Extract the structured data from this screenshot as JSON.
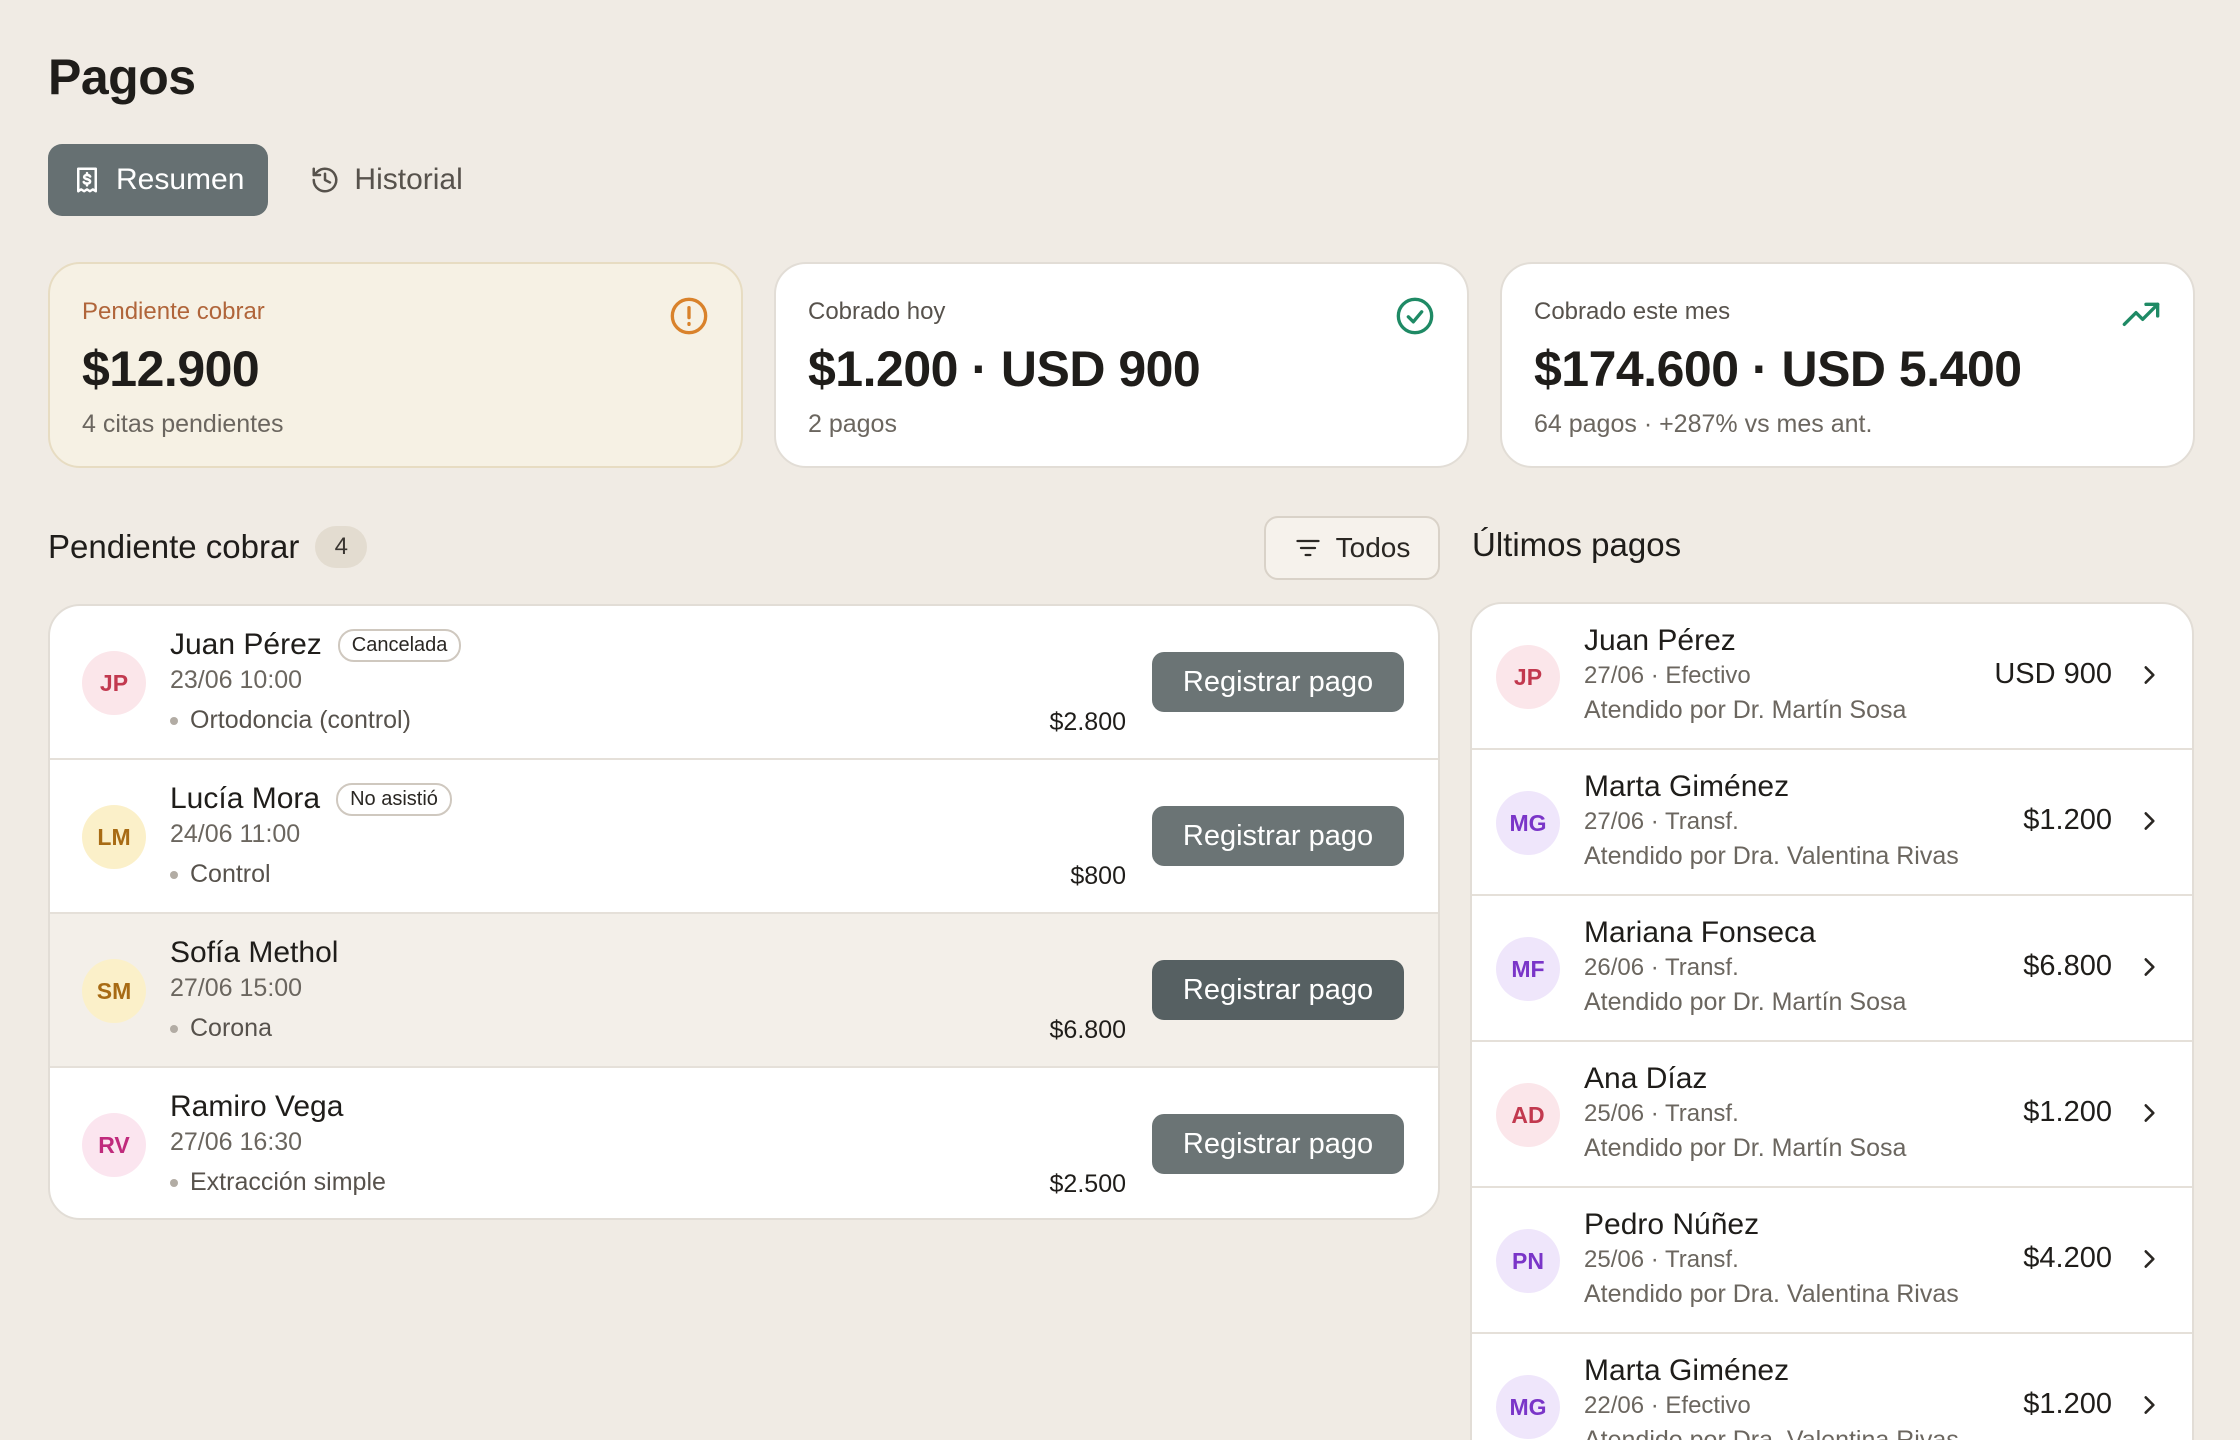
{
  "page": {
    "title": "Pagos"
  },
  "tabs": [
    {
      "label": "Resumen",
      "icon": "receipt-icon",
      "active": true
    },
    {
      "label": "Historial",
      "icon": "history-icon",
      "active": false
    }
  ],
  "summary_cards": [
    {
      "label": "Pendiente cobrar",
      "value": "$12.900",
      "sub": "4 citas pendientes",
      "icon": "alert-circle-icon",
      "accent": "#d9822b"
    },
    {
      "label": "Cobrado hoy",
      "value": "$1.200 · USD 900",
      "sub": "2 pagos",
      "icon": "check-circle-icon",
      "accent": "#1f8a65"
    },
    {
      "label": "Cobrado este mes",
      "value": "$174.600 · USD 5.400",
      "sub": "64 pagos · +287% vs mes ant.",
      "icon": "trending-up-icon",
      "accent": "#1f8a65"
    }
  ],
  "pending": {
    "title": "Pendiente cobrar",
    "count": "4",
    "filter_label": "Todos",
    "register_label": "Registrar pago",
    "rows": [
      {
        "initials": "JP",
        "name": "Juan Pérez",
        "status": "Cancelada",
        "datetime": "23/06 10:00",
        "treatment": "Ortodoncia (control)",
        "amount": "$2.800",
        "color": "red"
      },
      {
        "initials": "LM",
        "name": "Lucía Mora",
        "status": "No asistió",
        "datetime": "24/06 11:00",
        "treatment": "Control",
        "amount": "$800",
        "color": "yellow"
      },
      {
        "initials": "SM",
        "name": "Sofía Methol",
        "status": "",
        "datetime": "27/06 15:00",
        "treatment": "Corona",
        "amount": "$6.800",
        "color": "yellow"
      },
      {
        "initials": "RV",
        "name": "Ramiro Vega",
        "status": "",
        "datetime": "27/06 16:30",
        "treatment": "Extracción simple",
        "amount": "$2.500",
        "color": "pink"
      }
    ]
  },
  "recent": {
    "title": "Últimos pagos",
    "rows": [
      {
        "initials": "JP",
        "name": "Juan Pérez",
        "meta": "27/06 · Efectivo",
        "by": "Atendido por Dr. Martín Sosa",
        "amount": "USD 900",
        "color": "red"
      },
      {
        "initials": "MG",
        "name": "Marta Giménez",
        "meta": "27/06 · Transf.",
        "by": "Atendido por Dra. Valentina Rivas",
        "amount": "$1.200",
        "color": "purple"
      },
      {
        "initials": "MF",
        "name": "Mariana Fonseca",
        "meta": "26/06 · Transf.",
        "by": "Atendido por Dr. Martín Sosa",
        "amount": "$6.800",
        "color": "purple"
      },
      {
        "initials": "AD",
        "name": "Ana Díaz",
        "meta": "25/06 · Transf.",
        "by": "Atendido por Dr. Martín Sosa",
        "amount": "$1.200",
        "color": "red"
      },
      {
        "initials": "PN",
        "name": "Pedro Núñez",
        "meta": "25/06 · Transf.",
        "by": "Atendido por Dra. Valentina Rivas",
        "amount": "$4.200",
        "color": "purple"
      },
      {
        "initials": "MG",
        "name": "Marta Giménez",
        "meta": "22/06 · Efectivo",
        "by": "Atendido por Dra. Valentina Rivas",
        "amount": "$1.200",
        "color": "purple"
      }
    ]
  }
}
